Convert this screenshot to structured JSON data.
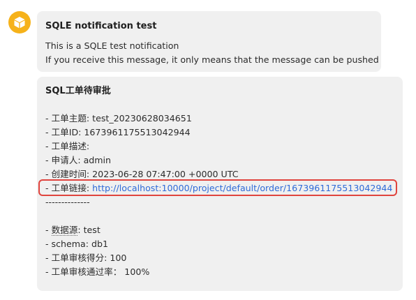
{
  "colors": {
    "avatar": "#f6b21a",
    "bubble": "#f0f0f0",
    "link": "#2f6bd8",
    "highlight": "#e0443e"
  },
  "avatar": {
    "icon": "box-icon"
  },
  "message1": {
    "title": "SQLE notification test",
    "lines": [
      "This is a SQLE test notification",
      "If you receive this message, it only means that the message can be pushed"
    ]
  },
  "message2": {
    "title": "SQL工单待审批",
    "subject": "- 工单主题: test_20230628034651",
    "id": "- 工单ID: 1673961175513042944",
    "desc": "- 工单描述:",
    "applicant": "- 申请人: admin",
    "created": "- 创建时间: 2023-06-28 07:47:00 +0000 UTC",
    "link_label": "- 工单链接: ",
    "link_url": "http://localhost:10000/project/default/order/1673961175513042944",
    "separator": "--------------",
    "source_prefix": "- ",
    "source_label": "数据源",
    "source_value": ": test",
    "schema": "- schema: db1",
    "score": "- 工单审核得分: 100",
    "pass_rate": "- 工单审核通过率： 100%"
  }
}
